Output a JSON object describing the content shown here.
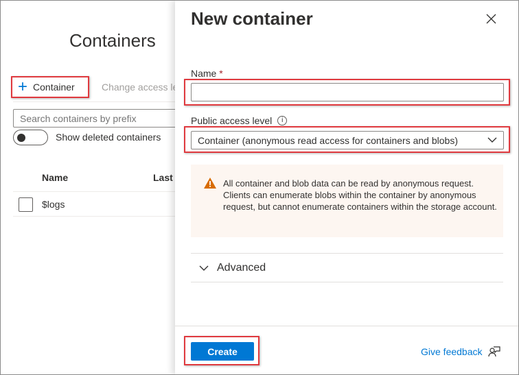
{
  "blade": {
    "title": "Containers",
    "toolbar": {
      "add_container_label": "Container",
      "change_access_label": "Change access level"
    },
    "search": {
      "placeholder": "Search containers by prefix",
      "value": ""
    },
    "show_deleted": {
      "label": "Show deleted containers",
      "on": false
    },
    "table": {
      "columns": [
        "Name",
        "Last modified"
      ],
      "rows": [
        {
          "name": "$logs"
        }
      ]
    }
  },
  "panel": {
    "title": "New container",
    "name_field": {
      "label": "Name",
      "required_marker": "*",
      "value": ""
    },
    "access_field": {
      "label": "Public access level",
      "value": "Container (anonymous read access for containers and blobs)"
    },
    "warning": "All container and blob data can be read by anonymous request. Clients can enumerate blobs within the container by anonymous request, but cannot enumerate containers within the storage account.",
    "advanced_label": "Advanced",
    "create_label": "Create",
    "feedback_label": "Give feedback"
  },
  "colors": {
    "accent": "#0078d4",
    "highlight": "#e0393e",
    "warning_bg": "#fdf6f1",
    "warning_icon": "#d86c00"
  }
}
